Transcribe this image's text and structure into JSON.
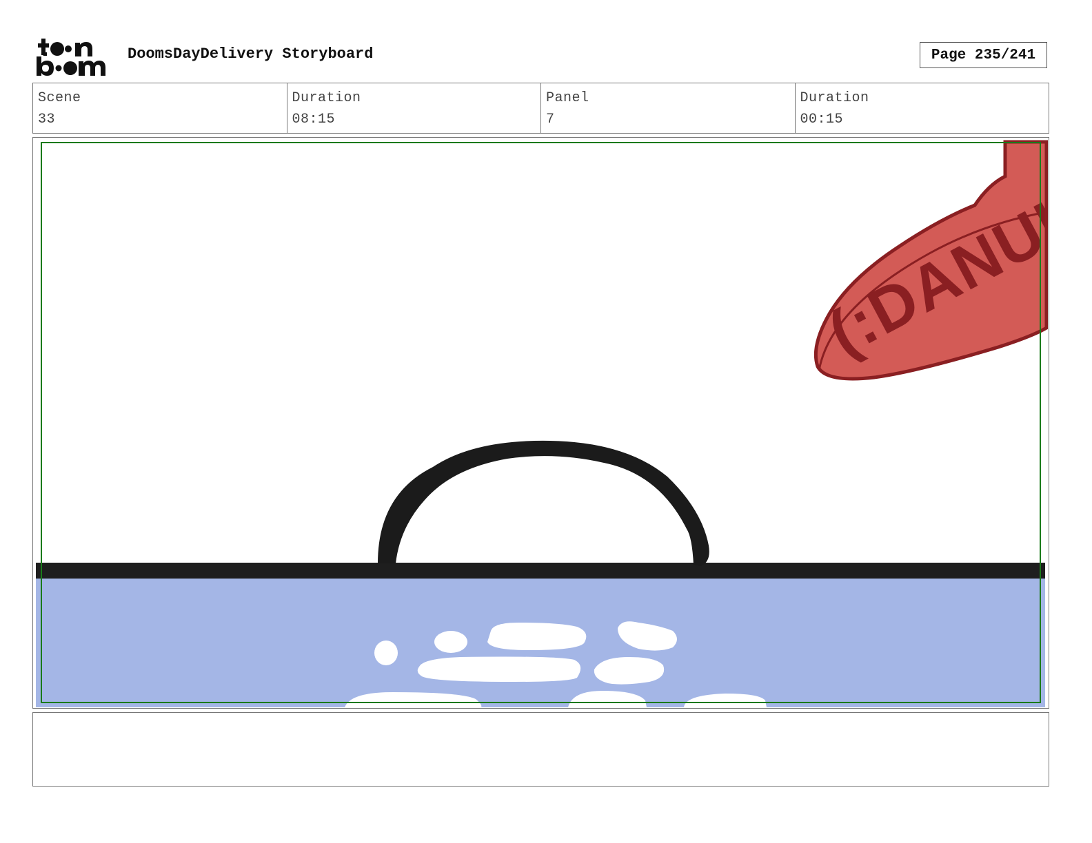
{
  "header": {
    "title": "DoomsDayDelivery Storyboard",
    "page_label": "Page 235/241",
    "logo_text": "toon boom"
  },
  "info": {
    "scene_label": "Scene",
    "scene_value": "33",
    "scene_duration_label": "Duration",
    "scene_duration_value": "08:15",
    "panel_label": "Panel",
    "panel_value": "7",
    "panel_duration_label": "Duration",
    "panel_duration_value": "00:15"
  },
  "panel": {
    "sign_text": "(:DANUKE",
    "colors": {
      "water": "#a4b6e6",
      "ground_line": "#1e1e1e",
      "sign_fill": "#d35b56",
      "sign_outline": "#8a1f22",
      "safe_frame": "#1a7a1a"
    }
  },
  "notes": {
    "text": ""
  }
}
